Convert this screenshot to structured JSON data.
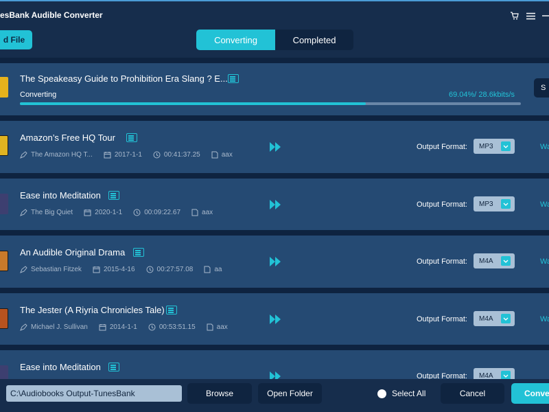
{
  "app": {
    "title": "esBank Audible Converter"
  },
  "toolbar": {
    "add_file_label": "d File"
  },
  "tabs": [
    {
      "label": "Converting",
      "active": true
    },
    {
      "label": "Completed",
      "active": false
    }
  ],
  "converting_item": {
    "title": "The Speakeasy Guide to Prohibition Era Slang ? E...",
    "status": "Converting",
    "speed": "69.04%/ 28.6kbits/s",
    "progress": 0.6904,
    "action_label": "S"
  },
  "output_format_label": "Output Format:",
  "pending_status": "Wa",
  "items": [
    {
      "title": "Amazon’s Free HQ Tour",
      "author": "The Amazon HQ T...",
      "date": "2017-1-1",
      "duration": "00:41:37.25",
      "format_type": "aax",
      "output_format": "MP3"
    },
    {
      "title": "Ease into Meditation",
      "author": "The Big Quiet",
      "date": "2020-1-1",
      "duration": "00:09:22.67",
      "format_type": "aax",
      "output_format": "MP3"
    },
    {
      "title": "An Audible Original Drama",
      "author": "Sebastian Fitzek",
      "date": "2015-4-16",
      "duration": "00:27:57.08",
      "format_type": "aa",
      "output_format": "M4A"
    },
    {
      "title": "The Jester (A Riyria Chronicles Tale)",
      "author": "Michael J. Sullivan",
      "date": "2014-1-1",
      "duration": "00:53:51.15",
      "format_type": "aax",
      "output_format": "M4A"
    },
    {
      "title": "Ease into Meditation",
      "author": "",
      "date": "",
      "duration": "",
      "format_type": "",
      "output_format": "M4A"
    }
  ],
  "bottom": {
    "output_path": "C:\\Audiobooks Output-TunesBank",
    "browse_label": "Browse",
    "open_folder_label": "Open Folder",
    "select_all_label": "Select All",
    "cancel_label": "Cancel",
    "convert_label": "Conver"
  },
  "colors": {
    "accent": "#22c2d6",
    "background": "#162d4c",
    "row": "#254a73",
    "button": "#0f2440"
  }
}
